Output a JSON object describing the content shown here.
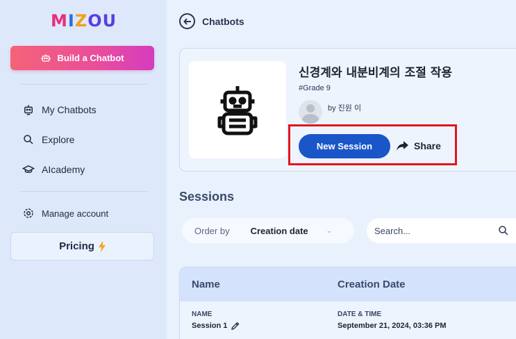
{
  "sidebar": {
    "logo": {
      "p1": "M",
      "p2": "I",
      "p3": "Z",
      "p4": "OU"
    },
    "build_button": "Build a Chatbot",
    "items": [
      {
        "label": "My Chatbots",
        "icon": "robot-icon"
      },
      {
        "label": "Explore",
        "icon": "search-icon"
      },
      {
        "label": "AIcademy",
        "icon": "graduation-cap-icon"
      }
    ],
    "manage_account": "Manage account",
    "pricing": "Pricing"
  },
  "header": {
    "back_label": "Chatbots"
  },
  "chatbot": {
    "title": "신경계와 내분비계의 조절 작용",
    "grade": "#Grade 9",
    "author": "by 진원 이",
    "new_session": "New Session",
    "share": "Share"
  },
  "sessions": {
    "title": "Sessions",
    "order_label": "Order by",
    "order_value": "Creation date",
    "search_placeholder": "Search...",
    "columns": [
      "Name",
      "Creation Date"
    ],
    "rows": [
      {
        "name_label": "NAME",
        "name": "Session 1",
        "date_label": "DATE & TIME",
        "date": "September 21, 2024, 03:36 PM"
      }
    ]
  },
  "colors": {
    "accent": "#1a56c8",
    "build_gradient_start": "#f46377",
    "build_gradient_end": "#d53cbf",
    "highlight": "#e3141c"
  }
}
